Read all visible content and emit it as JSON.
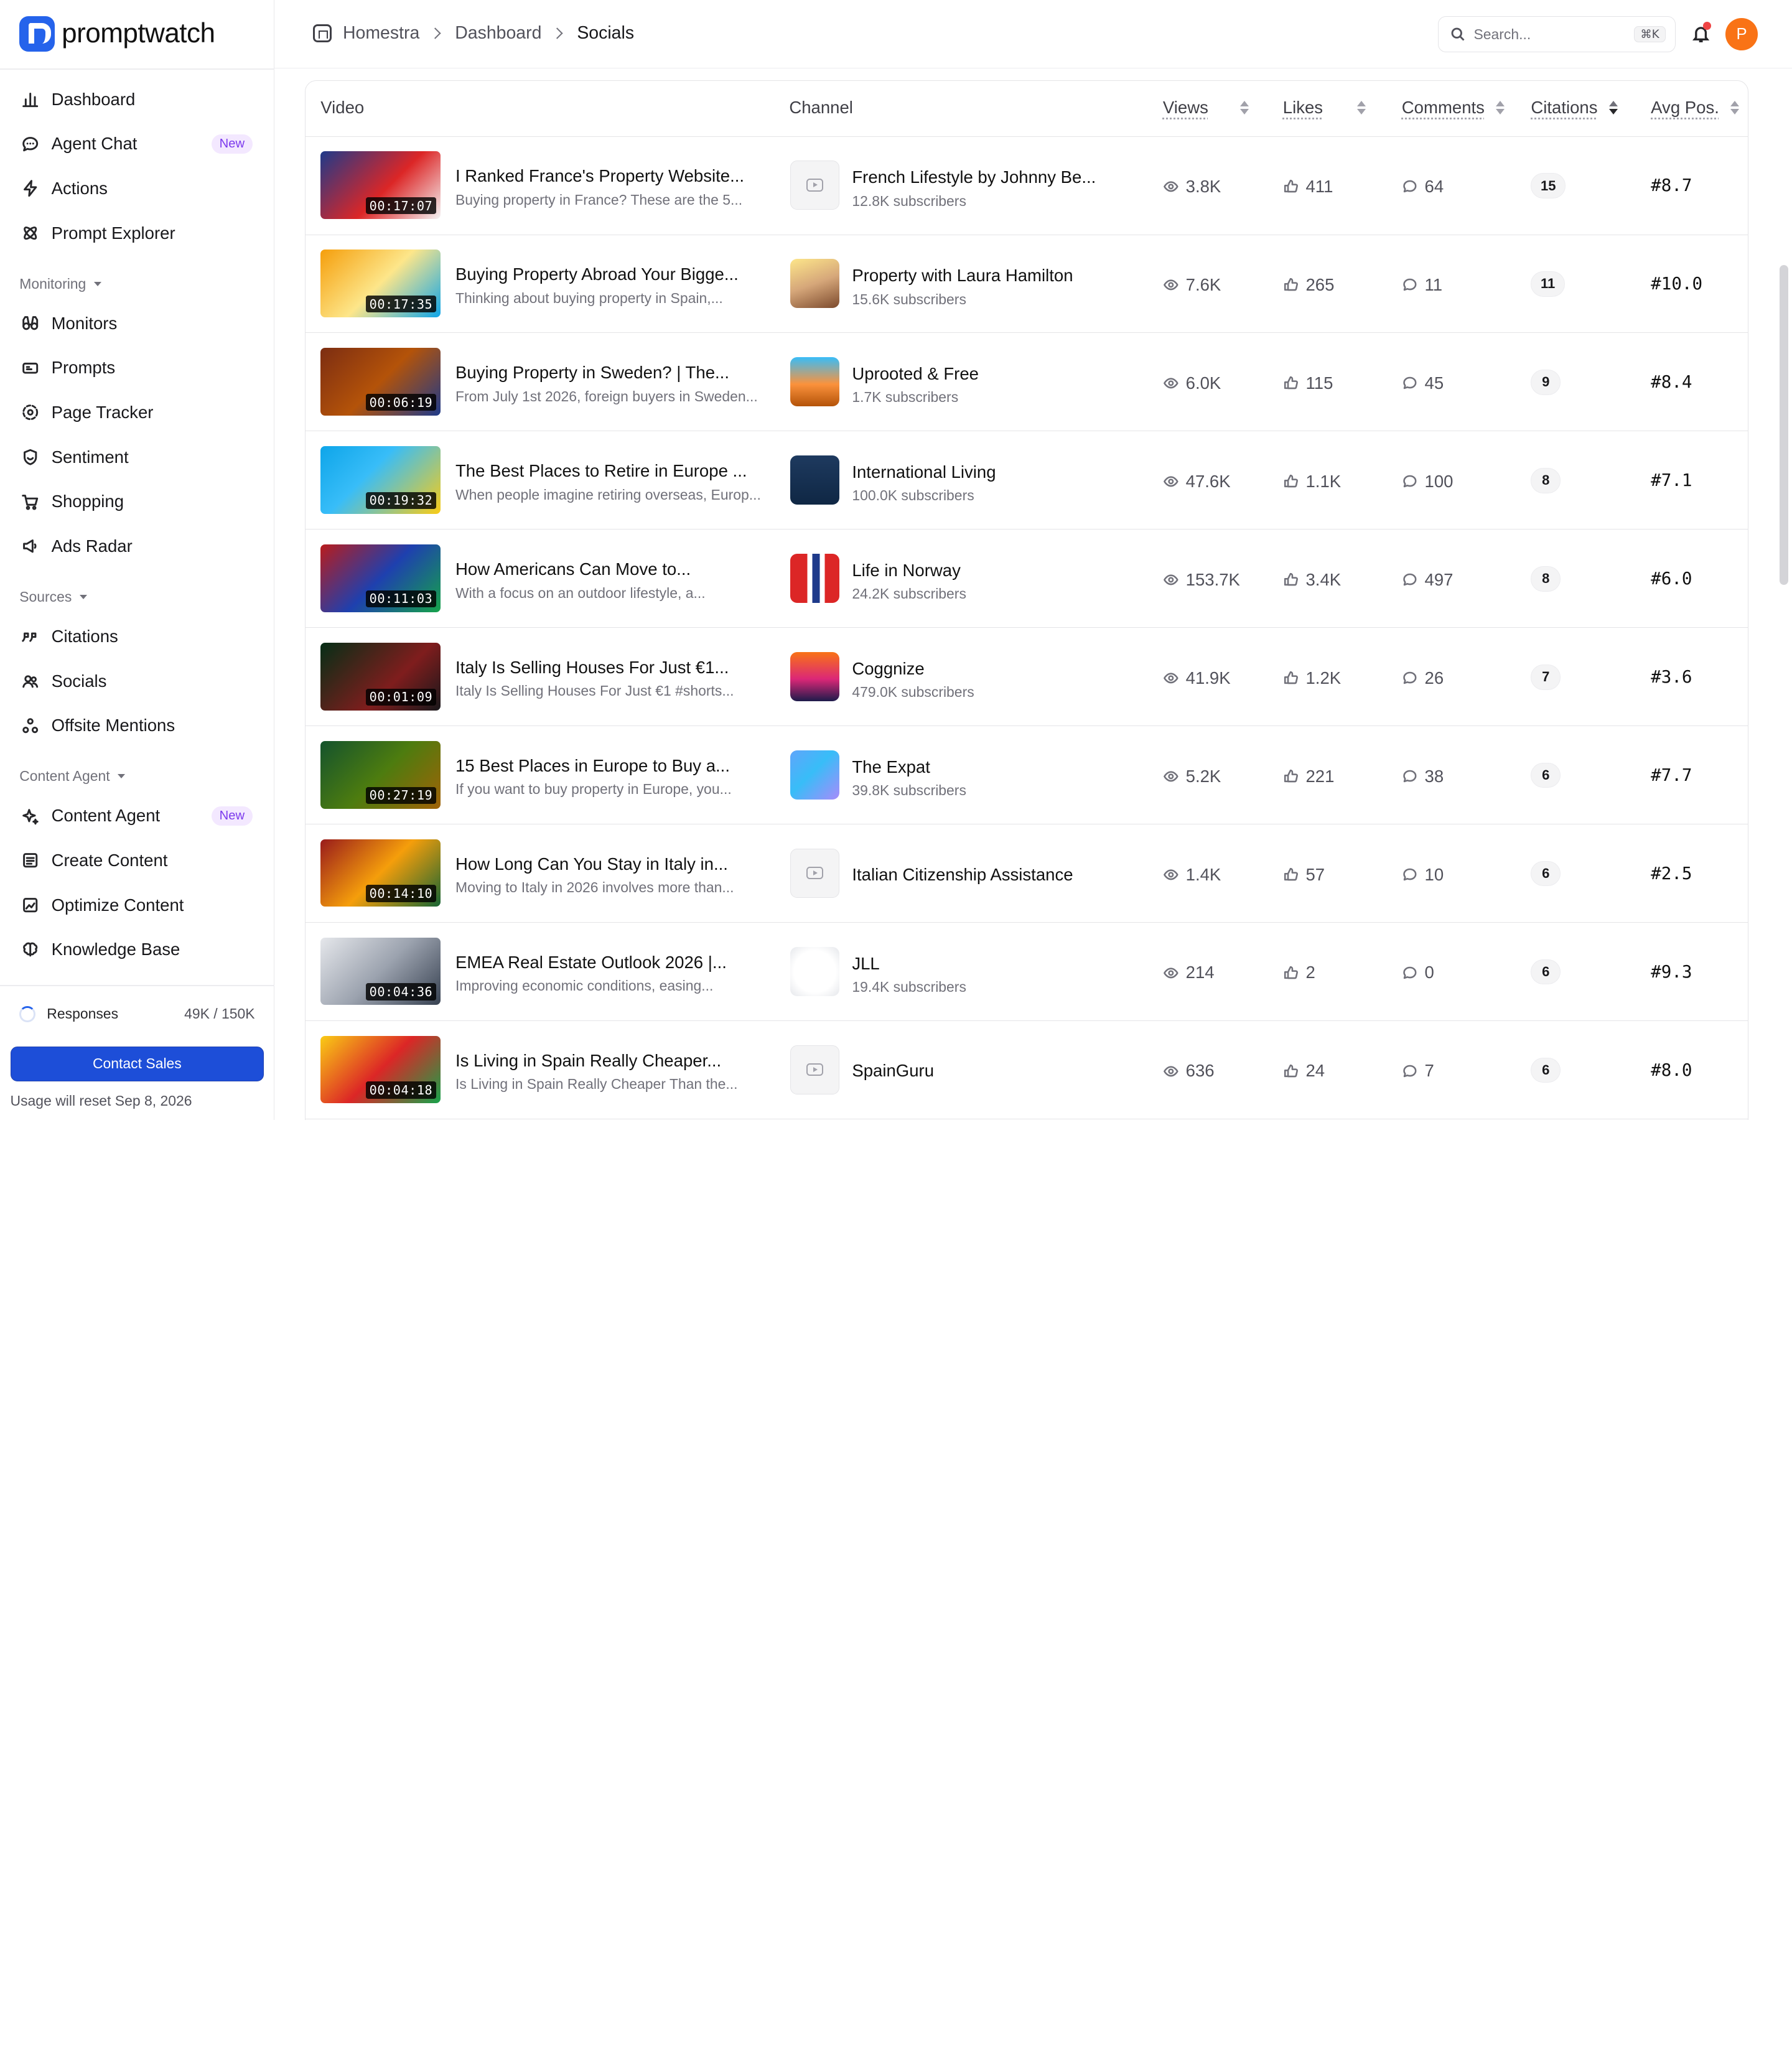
{
  "brand": {
    "name": "promptwatch",
    "accent": "#2563eb"
  },
  "sidebar": {
    "top_items": [
      {
        "label": "Dashboard",
        "icon": "bar-chart-icon"
      },
      {
        "label": "Agent Chat",
        "icon": "chat-bubble-icon",
        "badge": "New"
      },
      {
        "label": "Actions",
        "icon": "lightning-icon"
      },
      {
        "label": "Prompt Explorer",
        "icon": "atom-icon"
      }
    ],
    "monitoring_label": "Monitoring",
    "monitoring_items": [
      {
        "label": "Monitors",
        "icon": "binoculars-icon"
      },
      {
        "label": "Prompts",
        "icon": "message-square-icon"
      },
      {
        "label": "Page Tracker",
        "icon": "radar-icon"
      },
      {
        "label": "Sentiment",
        "icon": "shield-smile-icon"
      },
      {
        "label": "Shopping",
        "icon": "cart-icon"
      },
      {
        "label": "Ads Radar",
        "icon": "megaphone-icon"
      }
    ],
    "sources_label": "Sources",
    "sources_items": [
      {
        "label": "Citations",
        "icon": "quote-icon"
      },
      {
        "label": "Socials",
        "icon": "users-icon"
      },
      {
        "label": "Offsite Mentions",
        "icon": "share-nodes-icon"
      }
    ],
    "content_label": "Content Agent",
    "content_items": [
      {
        "label": "Content Agent",
        "icon": "sparkle-icon",
        "badge": "New"
      },
      {
        "label": "Create Content",
        "icon": "document-icon"
      },
      {
        "label": "Optimize Content",
        "icon": "image-chart-icon"
      },
      {
        "label": "Knowledge Base",
        "icon": "brain-icon"
      }
    ],
    "usage": {
      "label": "Responses",
      "count": "49K / 150K",
      "progress": 0.33
    },
    "contact_label": "Contact Sales",
    "reset_note": "Usage will reset Sep 8, 2026"
  },
  "header": {
    "breadcrumbs": [
      "Homestra",
      "Dashboard",
      "Socials"
    ],
    "search_placeholder": "Search...",
    "search_shortcut": "⌘K",
    "avatar_initial": "P"
  },
  "table": {
    "columns": [
      "Video",
      "Channel",
      "Views",
      "Likes",
      "Comments",
      "Citations",
      "Avg Pos."
    ],
    "rows": [
      {
        "title": "I Ranked France's Property Website...",
        "desc": "Buying property in France? These are the 5...",
        "duration": "00:17:07",
        "channel": "French Lifestyle by Johnny Be...",
        "subs": "12.8K subscribers",
        "views": "3.8K",
        "likes": "411",
        "comments": "64",
        "citations": "15",
        "avg_pos": "#8.7"
      },
      {
        "title": "Buying Property Abroad Your Bigge...",
        "desc": "Thinking about buying property in Spain,...",
        "duration": "00:17:35",
        "channel": "Property with Laura Hamilton",
        "subs": "15.6K subscribers",
        "views": "7.6K",
        "likes": "265",
        "comments": "11",
        "citations": "11",
        "avg_pos": "#10.0"
      },
      {
        "title": "Buying Property in Sweden? | The...",
        "desc": "From July 1st 2026, foreign buyers in Sweden...",
        "duration": "00:06:19",
        "channel": "Uprooted & Free",
        "subs": "1.7K subscribers",
        "views": "6.0K",
        "likes": "115",
        "comments": "45",
        "citations": "9",
        "avg_pos": "#8.4"
      },
      {
        "title": "The Best Places to Retire in Europe ...",
        "desc": "When people imagine retiring overseas, Europ...",
        "duration": "00:19:32",
        "channel": "International Living",
        "subs": "100.0K subscribers",
        "views": "47.6K",
        "likes": "1.1K",
        "comments": "100",
        "citations": "8",
        "avg_pos": "#7.1"
      },
      {
        "title": "How Americans Can Move to...",
        "desc": "With a focus on an outdoor lifestyle, a...",
        "duration": "00:11:03",
        "channel": "Life in Norway",
        "subs": "24.2K subscribers",
        "views": "153.7K",
        "likes": "3.4K",
        "comments": "497",
        "citations": "8",
        "avg_pos": "#6.0"
      },
      {
        "title": "Italy Is Selling Houses For Just €1...",
        "desc": "Italy Is Selling Houses For Just €1 #shorts...",
        "duration": "00:01:09",
        "channel": "Coggnize",
        "subs": "479.0K subscribers",
        "views": "41.9K",
        "likes": "1.2K",
        "comments": "26",
        "citations": "7",
        "avg_pos": "#3.6"
      },
      {
        "title": "15 Best Places in Europe to Buy a...",
        "desc": "If you want to buy property in Europe, you...",
        "duration": "00:27:19",
        "channel": "The Expat",
        "subs": "39.8K subscribers",
        "views": "5.2K",
        "likes": "221",
        "comments": "38",
        "citations": "6",
        "avg_pos": "#7.7"
      },
      {
        "title": "How Long Can You Stay in Italy in...",
        "desc": "Moving to Italy in 2026 involves more than...",
        "duration": "00:14:10",
        "channel": "Italian Citizenship Assistance",
        "subs": "",
        "views": "1.4K",
        "likes": "57",
        "comments": "10",
        "citations": "6",
        "avg_pos": "#2.5"
      },
      {
        "title": "EMEA Real Estate Outlook 2026 |...",
        "desc": "Improving economic conditions, easing...",
        "duration": "00:04:36",
        "channel": "JLL",
        "subs": "19.4K subscribers",
        "views": "214",
        "likes": "2",
        "comments": "0",
        "citations": "6",
        "avg_pos": "#9.3"
      },
      {
        "title": "Is Living in Spain Really Cheaper...",
        "desc": "Is Living in Spain Really Cheaper Than the...",
        "duration": "00:04:18",
        "channel": "SpainGuru",
        "subs": "",
        "views": "636",
        "likes": "24",
        "comments": "7",
        "citations": "6",
        "avg_pos": "#8.0"
      }
    ]
  }
}
